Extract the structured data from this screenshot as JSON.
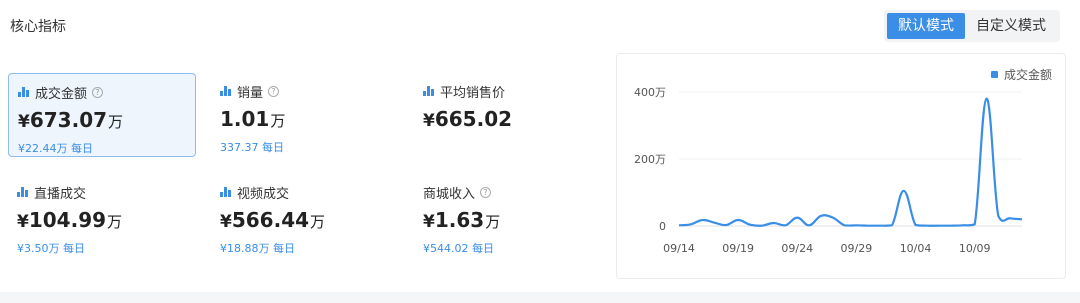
{
  "header": {
    "title": "核心指标"
  },
  "modes": [
    {
      "label": "默认模式",
      "active": true
    },
    {
      "label": "自定义模式",
      "active": false
    }
  ],
  "metrics": [
    {
      "label": "成交金额",
      "currency": "¥",
      "value": "673.07",
      "unit": "万",
      "sub": "¥22.44万 每日",
      "help": "?",
      "selected": true
    },
    {
      "label": "销量",
      "currency": "",
      "value": "1.01",
      "unit": "万",
      "sub": "337.37 每日",
      "help": "?"
    },
    {
      "label": "平均销售价",
      "currency": "¥",
      "value": "665.02",
      "unit": "",
      "sub": ""
    },
    {
      "label": "直播成交",
      "currency": "¥",
      "value": "104.99",
      "unit": "万",
      "sub": "¥3.50万 每日"
    },
    {
      "label": "视频成交",
      "currency": "¥",
      "value": "566.44",
      "unit": "万",
      "sub": "¥18.88万 每日"
    },
    {
      "label": "商城收入",
      "currency": "¥",
      "value": "1.63",
      "unit": "万",
      "sub": "¥544.02 每日",
      "help": "?"
    }
  ],
  "chart_data": {
    "type": "line",
    "legend": "成交金额",
    "legend_position": "top-right",
    "grid": true,
    "ylim": [
      0,
      4000000
    ],
    "yticks": [
      {
        "value": 0,
        "label": "0"
      },
      {
        "value": 2000000,
        "label": "200万"
      },
      {
        "value": 4000000,
        "label": "400万"
      }
    ],
    "xticks": [
      "09/14",
      "09/19",
      "09/24",
      "09/29",
      "10/04",
      "10/09"
    ],
    "x": [
      "09/14",
      "09/15",
      "09/16",
      "09/17",
      "09/18",
      "09/19",
      "09/20",
      "09/21",
      "09/22",
      "09/23",
      "09/24",
      "09/25",
      "09/26",
      "09/27",
      "09/28",
      "09/29",
      "09/30",
      "10/01",
      "10/02",
      "10/03",
      "10/04",
      "10/05",
      "10/06",
      "10/07",
      "10/08",
      "10/09",
      "10/10",
      "10/11",
      "10/12",
      "10/13"
    ],
    "series": [
      {
        "name": "成交金额",
        "color": "#3a8ee6",
        "values": [
          20000,
          50000,
          180000,
          100000,
          30000,
          180000,
          40000,
          10000,
          90000,
          20000,
          250000,
          20000,
          300000,
          250000,
          20000,
          20000,
          10000,
          10000,
          20000,
          1050000,
          30000,
          10000,
          10000,
          10000,
          20000,
          50000,
          3800000,
          300000,
          230000,
          200000
        ]
      }
    ]
  }
}
